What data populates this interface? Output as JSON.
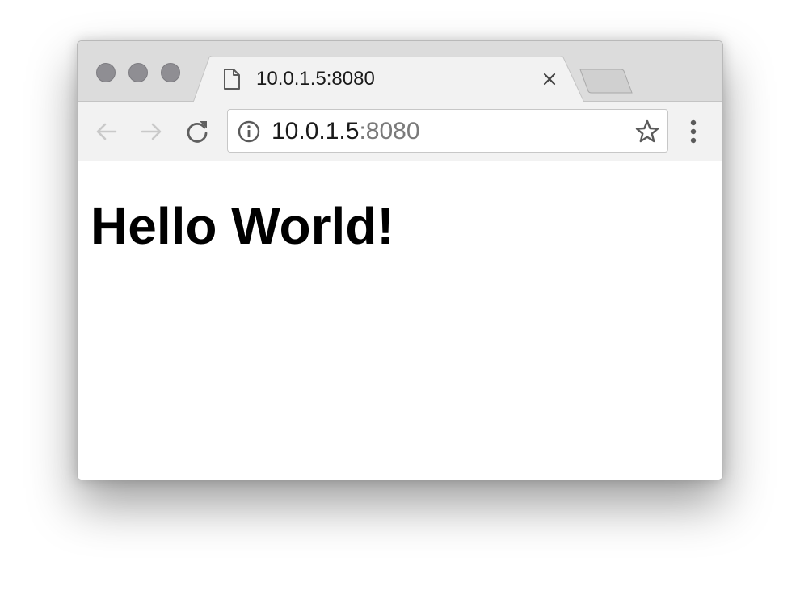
{
  "browser": {
    "tab": {
      "title": "10.0.1.5:8080",
      "icon": "document-icon"
    },
    "address_bar": {
      "host": "10.0.1.5",
      "port": ":8080"
    }
  },
  "page": {
    "heading": "Hello World!"
  }
}
